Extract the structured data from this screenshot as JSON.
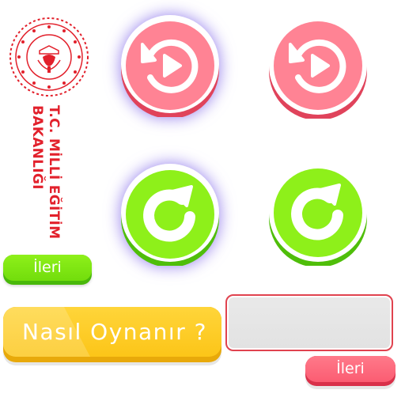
{
  "branding": {
    "ministry_line1": "T.C. MİLLİ EĞİTİM",
    "ministry_line2": "BAKANLIĞI",
    "logo_color": "#e2202b",
    "logo_icon": "ministry-emblem-icon"
  },
  "round_buttons": {
    "replay_icon": "replay-play-icon",
    "restart_icon": "restart-arrow-icon",
    "replay_color": "#ff8394",
    "restart_color": "#8ef01a",
    "glow_color": "#6e50e6"
  },
  "buttons": {
    "next_green_label": "İleri",
    "next_red_label": "İleri",
    "how_to_play_label": "Nasıl Oynanır ?"
  },
  "answer_box": {
    "value": ""
  },
  "colors": {
    "yellow": "#ffd53a",
    "green": "#8ef01a",
    "red": "#fb5c72",
    "input_border": "#e0434f"
  }
}
